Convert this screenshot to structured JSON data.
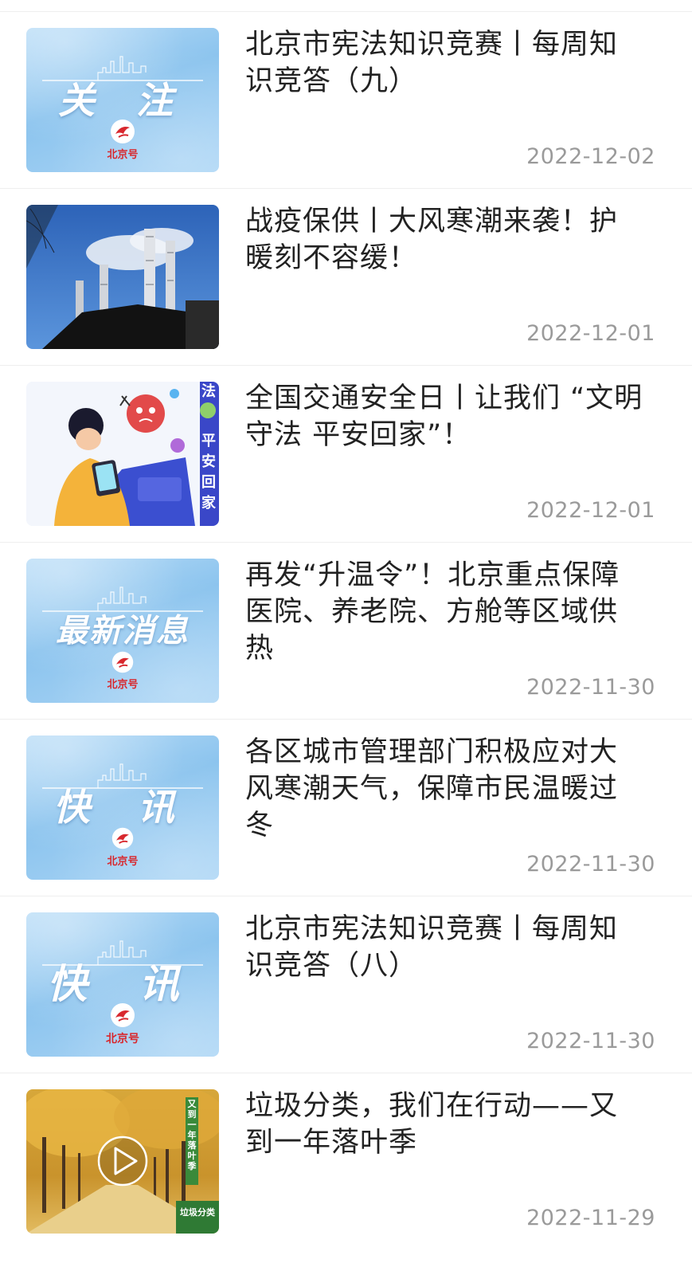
{
  "feed": {
    "items": [
      {
        "title": "北京市宪法知识竞赛丨每周知识竞答（九）",
        "date": "2022-12-02",
        "thumb": {
          "kind": "placard",
          "text": "关 注",
          "brand": "北京号"
        }
      },
      {
        "title": "战疫保供丨大风寒潮来袭！护暖刻不容缓！",
        "date": "2022-12-01",
        "thumb": {
          "kind": "photo-chimneys"
        }
      },
      {
        "title": "全国交通安全日丨让我们 “文明守法 平安回家”！",
        "date": "2022-12-01",
        "thumb": {
          "kind": "illustration-traffic",
          "side_text": [
            "法",
            "平",
            "安",
            "回",
            "家"
          ]
        }
      },
      {
        "title": "再发“升温令”！北京重点保障医院、养老院、方舱等区域供热",
        "date": "2022-11-30",
        "thumb": {
          "kind": "placard",
          "text": "最新消息",
          "brand": "北京号"
        }
      },
      {
        "title": "各区城市管理部门积极应对大风寒潮天气，保障市民温暖过冬",
        "date": "2022-11-30",
        "thumb": {
          "kind": "placard",
          "text": "快 讯",
          "brand": "北京号"
        }
      },
      {
        "title": "北京市宪法知识竞赛丨每周知识竞答（八）",
        "date": "2022-11-30",
        "thumb": {
          "kind": "placard",
          "text": "快 讯",
          "brand": "北京号"
        }
      },
      {
        "title": "垃圾分类，我们在行动——又到一年落叶季",
        "date": "2022-11-29",
        "thumb": {
          "kind": "video-ginkgo",
          "banner": "又到一年落叶季",
          "badge": "垃圾分类",
          "play_icon": "play-icon"
        }
      }
    ]
  },
  "colors": {
    "brand_red": "#d8282e",
    "title": "#222222",
    "date": "#9a9a9a",
    "placard_blue": "#8cc4ee"
  }
}
